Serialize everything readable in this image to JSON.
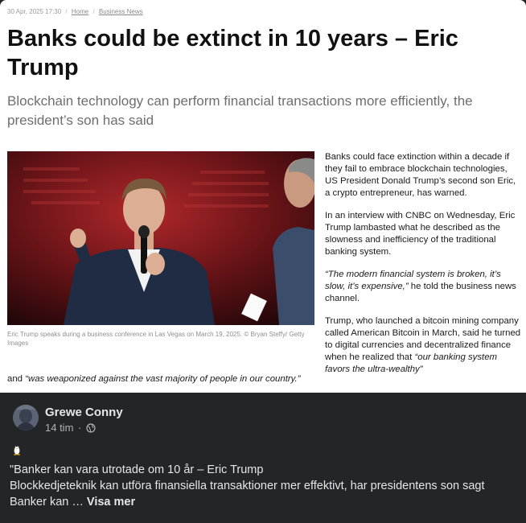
{
  "article": {
    "date": "30 Apr, 2025 17:30",
    "breadcrumb": [
      "Home",
      "Business News"
    ],
    "headline": "Banks could be extinct in 10 years – Eric Trump",
    "subheadline": "Blockchain technology can perform financial transactions more efficiently, the president’s son has said",
    "caption": "Eric Trump speaks during a business conference in Las Vegas on March 19, 2025. © Bryan Steffy/ Getty Images",
    "paragraphs": {
      "p1": "Banks could face extinction within a decade if they fail to embrace blockchain technologies, US President Donald Trump’s second son Eric, a crypto entrepreneur, has warned.",
      "p2": "In an interview with CNBC on Wednesday, Eric Trump lambasted what he described as the slowness and inefficiency of the traditional banking system.",
      "p3_quote": "“The modern financial system is broken, it’s slow, it’s expensive,”",
      "p3_rest": " he told the business news channel.",
      "p4": "Trump, who launched a bitcoin mining company called American Bitcoin in March, said he turned to digital currencies and decentralized finance when he realized that ",
      "p4_quote": "“our banking system favors the ultra-wealthy”",
      "tail_lead": "and ",
      "tail_quote": "“was weaponized against the vast majority of people in our country.”"
    }
  },
  "post": {
    "author": "Grewe Conny",
    "time": "14 tim",
    "time_separator": "·",
    "emoji_icon": "penguin-icon",
    "text_line1": "\"Banker kan vara utrotade om 10 år – Eric Trump",
    "text_line2": "Blockkedjeteknik kan utföra finansiella transaktioner mer effektivt, har presidentens son sagt",
    "text_line3": "Banker kan … ",
    "see_more": "Visa mer"
  },
  "colors": {
    "post_background": "#242526",
    "article_background": "#ffffff",
    "headline_color": "#111111",
    "subheadline_color": "#6e6e6e"
  }
}
